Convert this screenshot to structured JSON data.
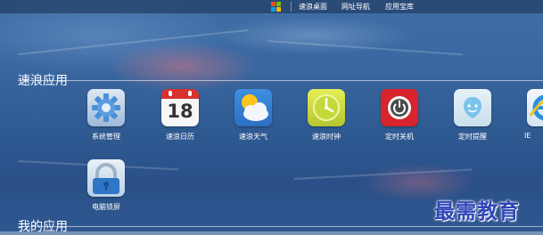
{
  "topbar": {
    "items": [
      {
        "label": "速浪桌面"
      },
      {
        "label": "网址导航"
      },
      {
        "label": "应用宝库"
      }
    ]
  },
  "sections": {
    "suliang": {
      "title": "速浪应用"
    },
    "mine": {
      "title": "我的应用"
    }
  },
  "apps": [
    {
      "label": "系统管理",
      "icon": "gear-icon"
    },
    {
      "label": "速浪日历",
      "icon": "calendar-icon",
      "day": "18"
    },
    {
      "label": "速浪天气",
      "icon": "weather-icon"
    },
    {
      "label": "速浪时钟",
      "icon": "clock-icon"
    },
    {
      "label": "定时关机",
      "icon": "power-icon"
    },
    {
      "label": "定时提醒",
      "icon": "reminder-icon"
    },
    {
      "label": "IE",
      "icon": "ie-icon"
    },
    {
      "label": "电脑锁屏",
      "icon": "lock-icon"
    }
  ],
  "watermark": "最需教育"
}
